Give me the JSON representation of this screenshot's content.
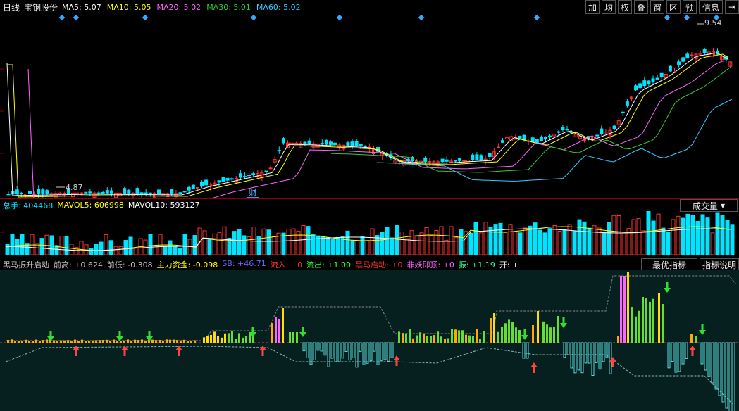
{
  "header": {
    "period": "日线",
    "stock": "宝钢股份",
    "ma": [
      {
        "label": "MA5: 5.07",
        "color": "#ffffff"
      },
      {
        "label": "MA10: 5.05",
        "color": "#ffff00"
      },
      {
        "label": "MA20: 5.02",
        "color": "#ff66ff"
      },
      {
        "label": "MA30: 5.01",
        "color": "#33cc33"
      },
      {
        "label": "MA60: 5.02",
        "color": "#33ccff"
      }
    ],
    "toolbar": [
      "加",
      "均",
      "权",
      "叠",
      "窗",
      "区",
      "预",
      "信息",
      "⇥"
    ]
  },
  "price": {
    "max_label": "9.54",
    "min_label": "4.87",
    "cai_label": "财"
  },
  "volume": {
    "zongshou": "总手: 404468",
    "mavol5": "MAVOL5: 606998",
    "mavol10": "MAVOL10: 593127",
    "dropdown": "成交量"
  },
  "indicator": {
    "name": "黑马振升启动",
    "items": [
      {
        "text": "前高: +0.624",
        "color": "#bbbbbb"
      },
      {
        "text": "前低: -0.308",
        "color": "#bbbbbb"
      },
      {
        "text": "主力资金: -0.098",
        "color": "#ffff00"
      },
      {
        "text": "SB: +46.71",
        "color": "#6666ff"
      },
      {
        "text": "流入: +0",
        "color": "#ff3333"
      },
      {
        "text": "流出: +1.00",
        "color": "#33ff33"
      },
      {
        "text": "黑马启动: +0",
        "color": "#ff3333"
      },
      {
        "text": "非妖即顶: +0",
        "color": "#ff66ff"
      },
      {
        "text": "振: +1.19",
        "color": "#33ff99"
      },
      {
        "text": "开: +",
        "color": "#ffffff"
      }
    ],
    "best_button": "最优指标",
    "explain_button": "指标说明"
  },
  "colors": {
    "up": "#ff3333",
    "down": "#00e5ff"
  }
}
